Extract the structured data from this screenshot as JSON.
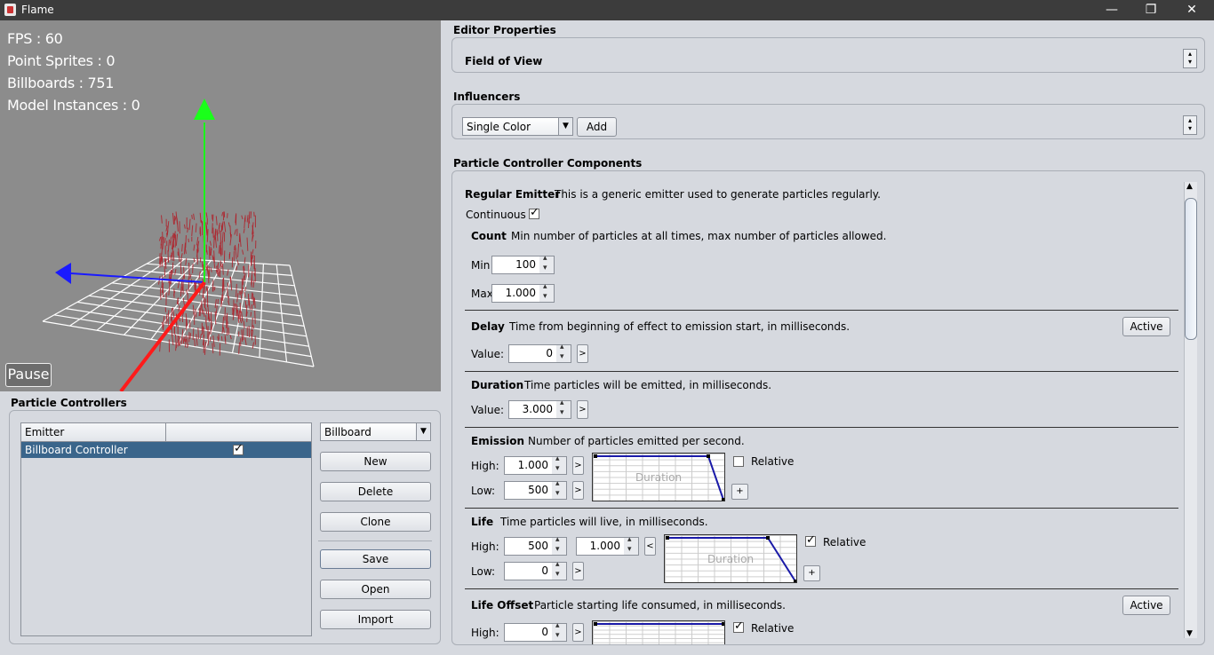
{
  "window": {
    "title": "Flame",
    "minimize": "—",
    "restore": "❐",
    "close": "✕"
  },
  "viewport": {
    "stats": [
      "FPS : 60",
      "Point Sprites : 0",
      "Billboards : 751",
      "Model Instances : 0"
    ],
    "pause_label": "Pause",
    "axis_colors": {
      "x": "#ff1a1a",
      "y": "#1aff1a",
      "z": "#1a1aff"
    },
    "particle_color": "#b0202a"
  },
  "controllers": {
    "title": "Particle Controllers",
    "table": {
      "headers": [
        "Emitter",
        ""
      ],
      "rows": [
        {
          "name": "Billboard Controller",
          "enabled": true
        }
      ]
    },
    "type_select": "Billboard",
    "buttons": {
      "new": "New",
      "delete": "Delete",
      "clone": "Clone",
      "save": "Save",
      "open": "Open",
      "import": "Import"
    }
  },
  "editor_properties": {
    "title": "Editor Properties",
    "field_label": "Field of View"
  },
  "influencers": {
    "title": "Influencers",
    "select": "Single Color",
    "add": "Add"
  },
  "components": {
    "title": "Particle Controller Components",
    "regular_emitter": {
      "title": "Regular Emitter",
      "desc": "This is a generic emitter used to generate particles regularly.",
      "continuous_label": "Continuous",
      "continuous": true
    },
    "count": {
      "title": "Count",
      "desc": "Min number of particles at all times, max number of particles allowed.",
      "min_label": "Min",
      "min": "100",
      "max_label": "Max",
      "max": "1.000"
    },
    "delay": {
      "title": "Delay",
      "desc": "Time from beginning of effect to emission start, in milliseconds.",
      "active": "Active",
      "value_label": "Value:",
      "value": "0",
      "expand": ">"
    },
    "duration": {
      "title": "Duration",
      "desc": "Time particles will be emitted, in milliseconds.",
      "value_label": "Value:",
      "value": "3.000",
      "expand": ">"
    },
    "emission": {
      "title": "Emission",
      "desc": "Number of particles emitted per second.",
      "high_label": "High:",
      "high": "1.000",
      "low_label": "Low:",
      "low": "500",
      "expand": ">",
      "relative_label": "Relative",
      "relative": false,
      "plus": "+",
      "chart_label": "Duration"
    },
    "life": {
      "title": "Life",
      "desc": "Time particles will live, in milliseconds.",
      "high_label": "High:",
      "high": "500",
      "high2": "1.000",
      "collapse": "<",
      "low_label": "Low:",
      "low": "0",
      "expand": ">",
      "relative_label": "Relative",
      "relative": true,
      "plus": "+",
      "chart_label": "Duration"
    },
    "life_offset": {
      "title": "Life Offset",
      "desc": "Particle starting life consumed, in milliseconds.",
      "active": "Active",
      "high_label": "High:",
      "high": "0",
      "expand": ">",
      "relative_label": "Relative",
      "relative": true
    }
  }
}
